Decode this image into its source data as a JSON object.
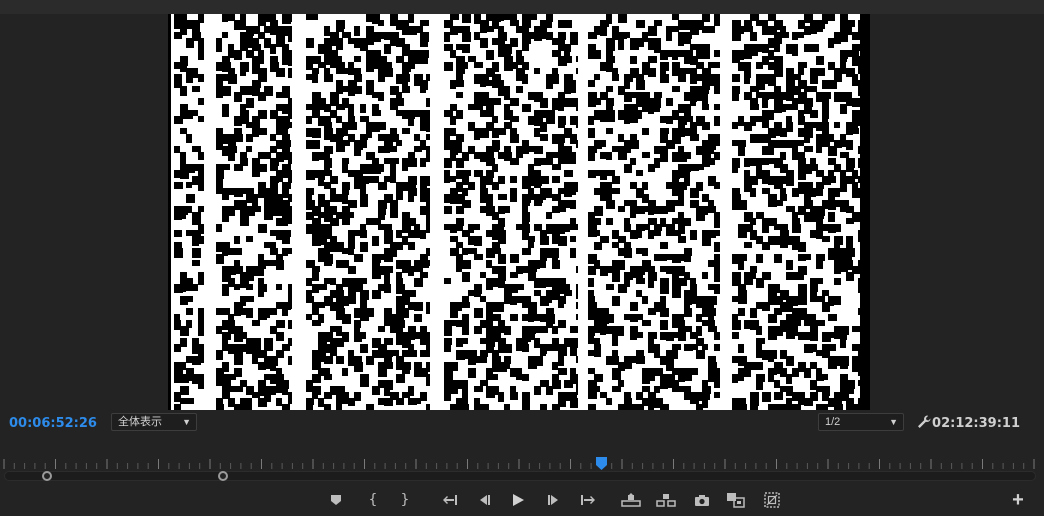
{
  "monitor": {
    "current_timecode": "00:06:52:26",
    "duration_timecode": "02:12:39:11",
    "zoom_select": {
      "value": "全体表示"
    },
    "resolution_select": {
      "value": "1/2"
    }
  },
  "colors": {
    "accent": "#2d8ceb",
    "panel_bg": "#232323",
    "icon": "#bdbdbd"
  },
  "transport": {
    "buttons": [
      {
        "name": "add-marker-button",
        "icon": "marker-icon"
      },
      {
        "name": "mark-in-button",
        "icon": "bracket-open-icon",
        "glyph": "{"
      },
      {
        "name": "mark-out-button",
        "icon": "bracket-close-icon",
        "glyph": "}"
      },
      {
        "name": "go-to-in-button",
        "icon": "go-to-in-icon"
      },
      {
        "name": "step-back-button",
        "icon": "step-back-icon"
      },
      {
        "name": "play-button",
        "icon": "play-icon"
      },
      {
        "name": "step-forward-button",
        "icon": "step-forward-icon"
      },
      {
        "name": "go-to-out-button",
        "icon": "go-to-out-icon"
      },
      {
        "name": "lift-button",
        "icon": "lift-icon"
      },
      {
        "name": "extract-button",
        "icon": "extract-icon"
      },
      {
        "name": "export-frame-button",
        "icon": "camera-icon"
      },
      {
        "name": "comparison-view-button",
        "icon": "compare-icon"
      },
      {
        "name": "safe-margins-button",
        "icon": "safe-margins-icon"
      }
    ],
    "add_button": {
      "glyph": "+"
    }
  },
  "timeline": {
    "playhead_fraction": 0.574,
    "zoom_range_fraction": [
      0.04,
      0.21
    ]
  }
}
